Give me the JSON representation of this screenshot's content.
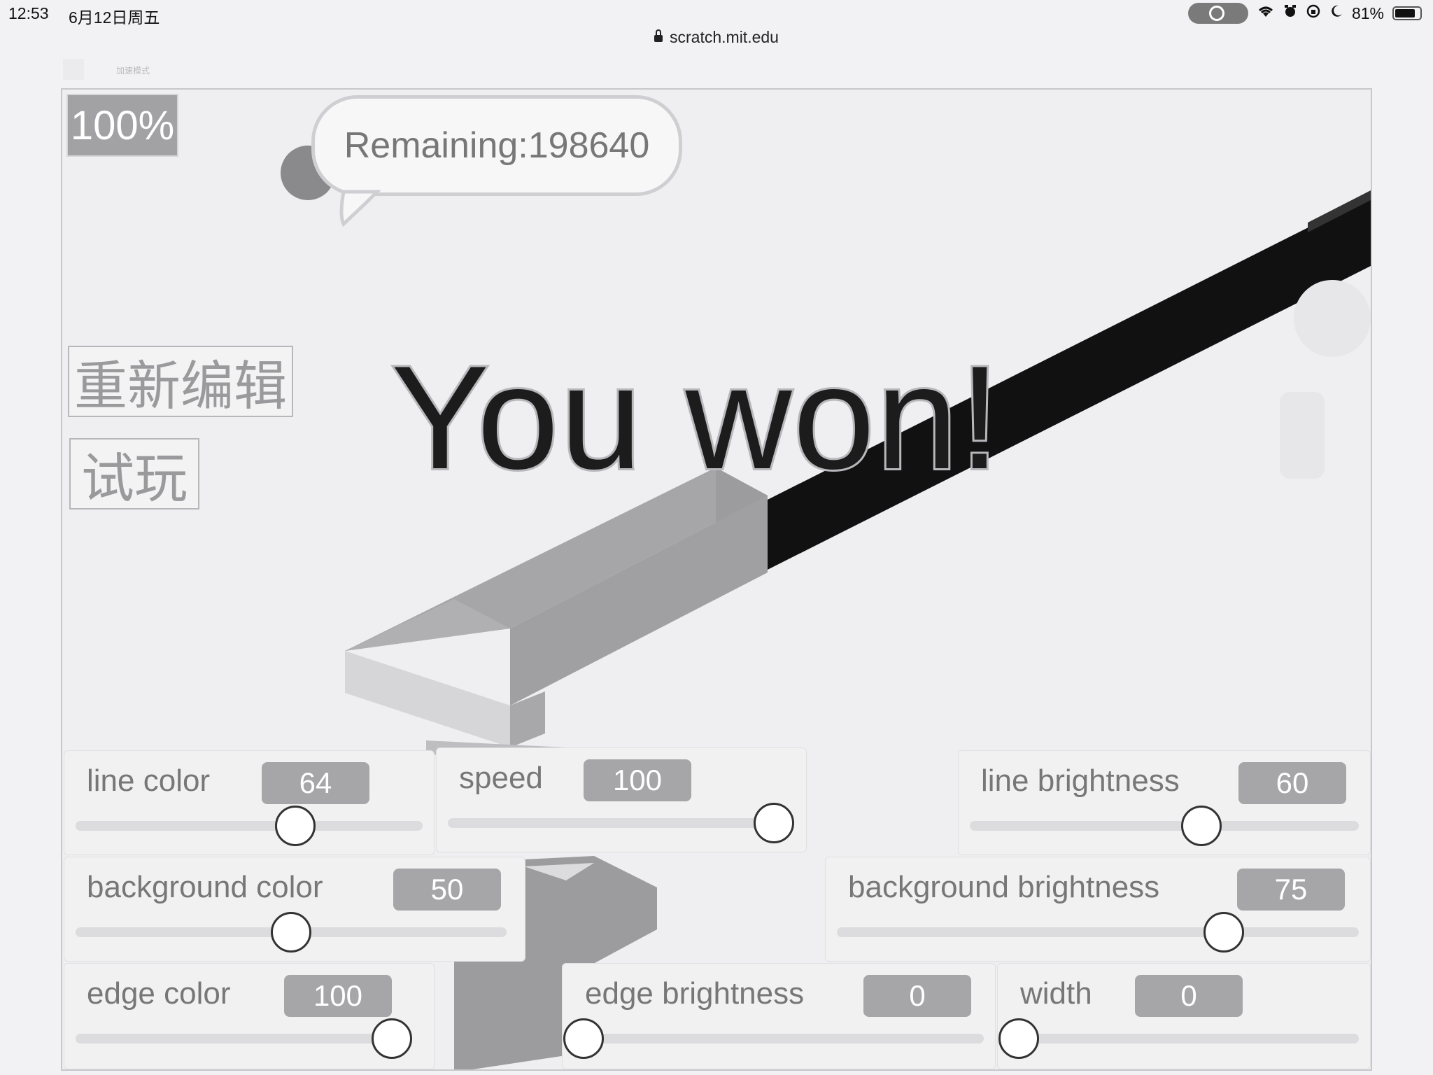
{
  "status": {
    "time": "12:53",
    "date": "6月12日周五",
    "battery_text": "81%",
    "battery_level": 0.81
  },
  "browser": {
    "url": "scratch.mit.edu",
    "mode_text": "加速模式"
  },
  "stage": {
    "zoom": "100%",
    "speech": "Remaining:198640",
    "edit_button": "重新编辑",
    "play_button": "试玩",
    "message": "You won!"
  },
  "sliders": [
    {
      "label": "line color",
      "value": "64",
      "level": 0.64
    },
    {
      "label": "speed",
      "value": "100",
      "level": 1.0
    },
    {
      "label": "line brightness",
      "value": "60",
      "level": 0.6
    },
    {
      "label": "background color",
      "value": "50",
      "level": 0.5
    },
    {
      "label": "background brightness",
      "value": "75",
      "level": 0.75
    },
    {
      "label": "edge color",
      "value": "100",
      "level": 1.0
    },
    {
      "label": "edge brightness",
      "value": "0",
      "level": 0.0
    },
    {
      "label": "width",
      "value": "0",
      "level": 0.0
    }
  ],
  "colors": {
    "track_dark": "#111111",
    "track_mid": "#9c9c9e",
    "track_light": "#d6d6d8",
    "stage_bg": "#efeef0"
  }
}
